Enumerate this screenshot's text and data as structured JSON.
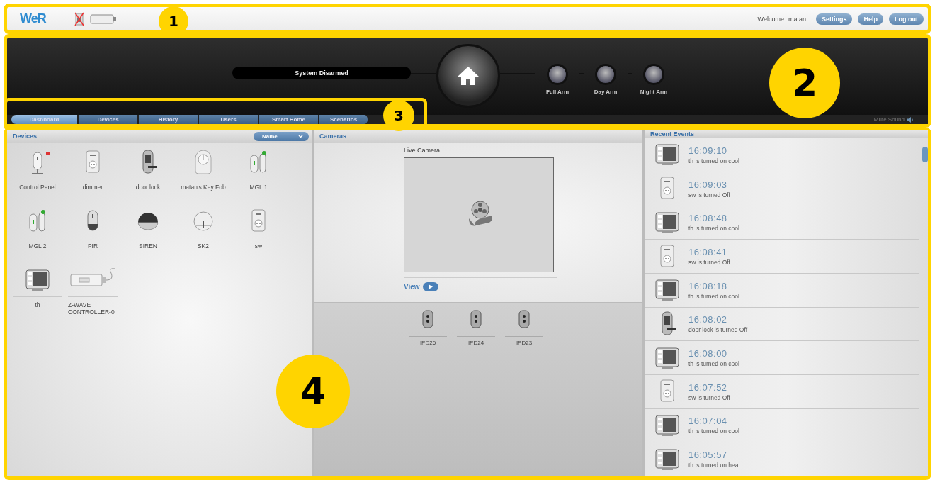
{
  "header": {
    "logo": "WeR",
    "welcome": "Welcome",
    "user": "matan",
    "buttons": [
      "Settings",
      "Help",
      "Log out"
    ]
  },
  "arm_panel": {
    "status": "System Disarmed",
    "modes": [
      {
        "label": "Full Arm"
      },
      {
        "label": "Day Arm"
      },
      {
        "label": "Night Arm"
      }
    ],
    "mute": "Mute Sound"
  },
  "tabs": [
    {
      "label": "Dashboard",
      "selected": true
    },
    {
      "label": "Devices",
      "selected": false
    },
    {
      "label": "History",
      "selected": false
    },
    {
      "label": "Users",
      "selected": false
    },
    {
      "label": "Smart Home",
      "selected": false
    },
    {
      "label": "Scenarios",
      "selected": false
    }
  ],
  "devices": {
    "title": "Devices",
    "sort": "Name",
    "items": [
      {
        "name": "Control Panel",
        "kind": "panel"
      },
      {
        "name": "dimmer",
        "kind": "plug"
      },
      {
        "name": "door lock",
        "kind": "keypad"
      },
      {
        "name": "matan's Key Fob",
        "kind": "fob"
      },
      {
        "name": "MGL 1",
        "kind": "contact"
      },
      {
        "name": "MGL 2",
        "kind": "contact"
      },
      {
        "name": "PIR",
        "kind": "pir"
      },
      {
        "name": "SIREN",
        "kind": "siren"
      },
      {
        "name": "SK2",
        "kind": "dial"
      },
      {
        "name": "sw",
        "kind": "plug"
      },
      {
        "name": "th",
        "kind": "thermostat"
      },
      {
        "name": "Z-WAVE CONTROLLER-0",
        "kind": "usb"
      }
    ]
  },
  "cameras": {
    "title": "Cameras",
    "live_label": "Live Camera",
    "view": "View",
    "items": [
      {
        "name": "IPD26"
      },
      {
        "name": "IPD24"
      },
      {
        "name": "IPD23"
      }
    ]
  },
  "events": {
    "title": "Recent Events",
    "items": [
      {
        "time": "16:09:10",
        "text": "th is turned on cool",
        "kind": "thermostat"
      },
      {
        "time": "16:09:03",
        "text": "sw is turned Off",
        "kind": "plug"
      },
      {
        "time": "16:08:48",
        "text": "th is turned on cool",
        "kind": "thermostat"
      },
      {
        "time": "16:08:41",
        "text": "sw is turned Off",
        "kind": "plug"
      },
      {
        "time": "16:08:18",
        "text": "th is turned on cool",
        "kind": "thermostat"
      },
      {
        "time": "16:08:02",
        "text": "door lock is turned Off",
        "kind": "keypad"
      },
      {
        "time": "16:08:00",
        "text": "th is turned on cool",
        "kind": "thermostat"
      },
      {
        "time": "16:07:52",
        "text": "sw is turned Off",
        "kind": "plug"
      },
      {
        "time": "16:07:04",
        "text": "th is turned on cool",
        "kind": "thermostat"
      },
      {
        "time": "16:05:57",
        "text": "th is turned on heat",
        "kind": "thermostat"
      }
    ]
  },
  "annotations": [
    "1",
    "2",
    "3",
    "4"
  ]
}
